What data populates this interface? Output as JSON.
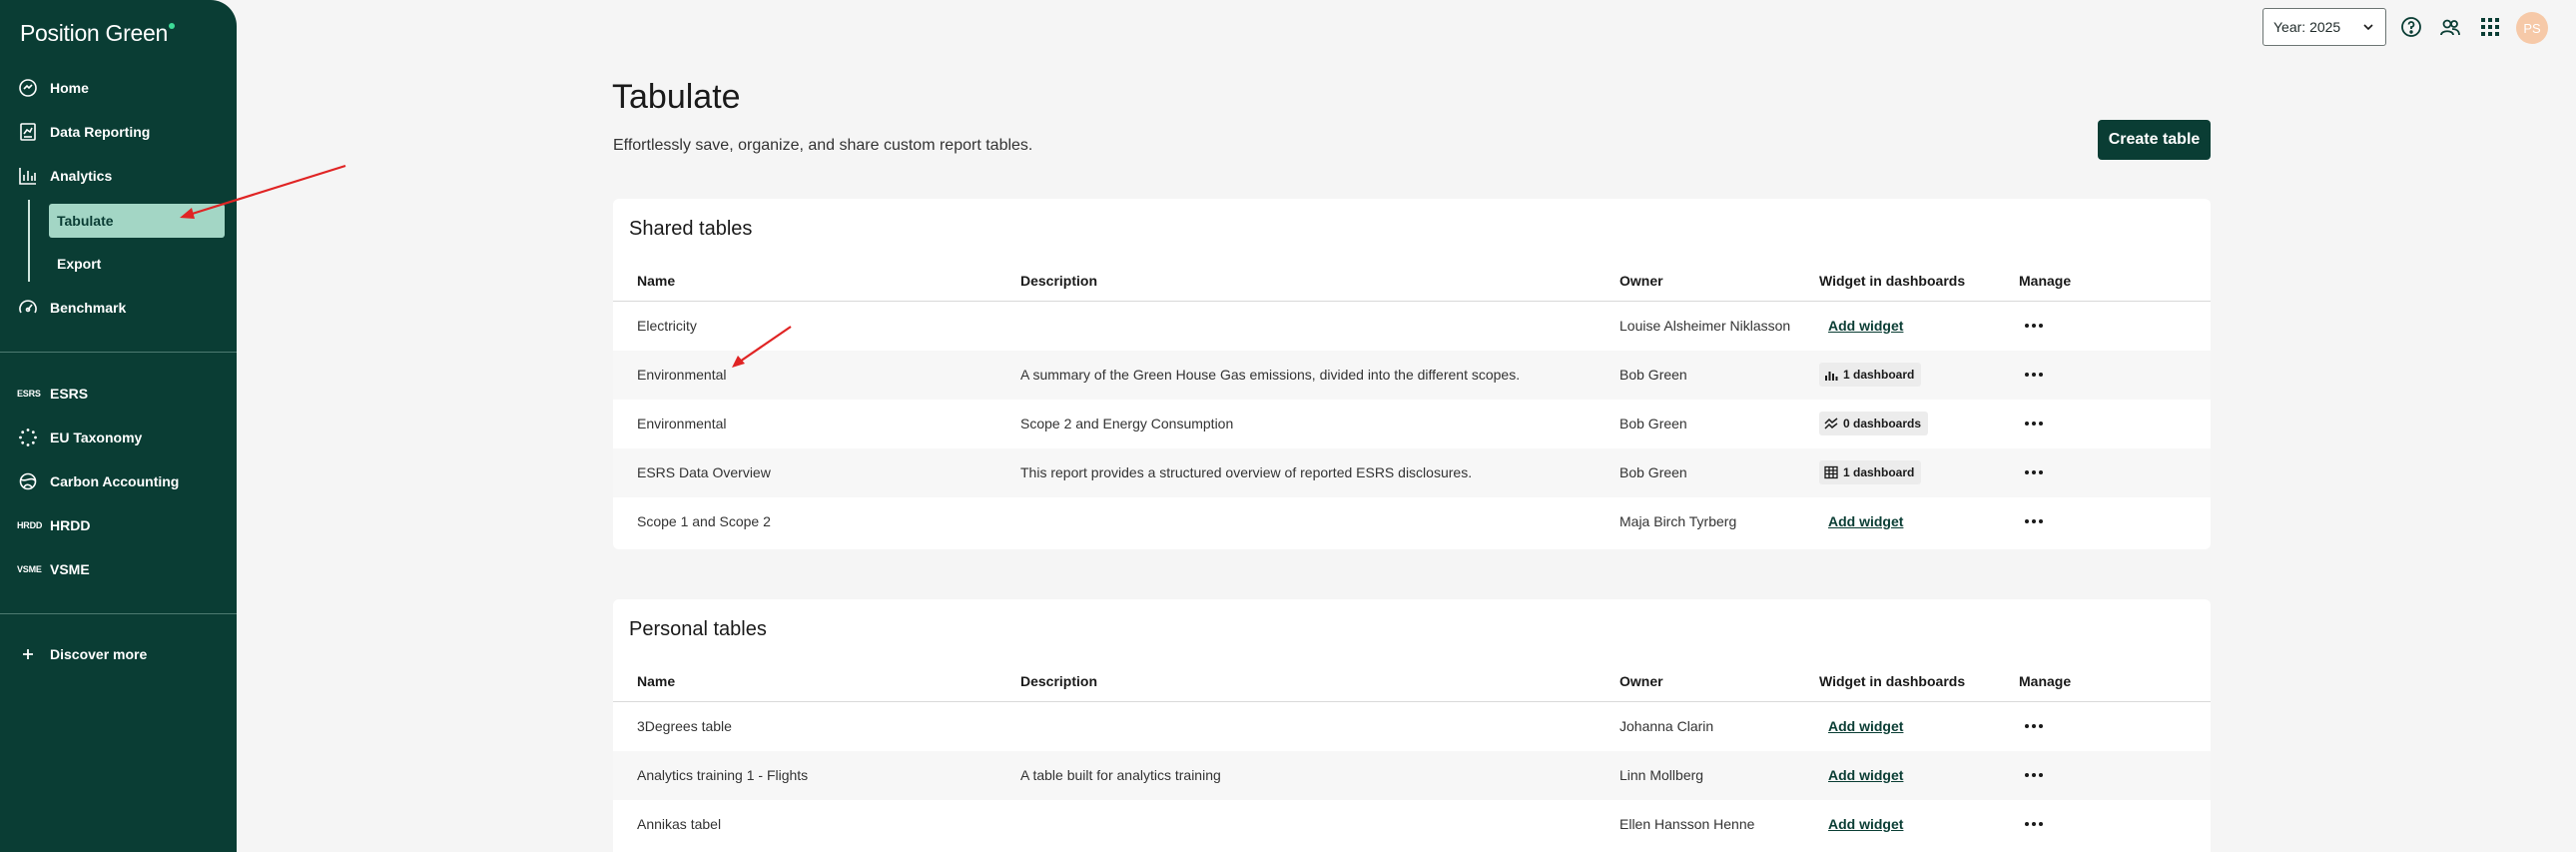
{
  "app": {
    "logo_text": "Position Green"
  },
  "sidebar": {
    "items": [
      {
        "label": "Home",
        "icon": "home-icon"
      },
      {
        "label": "Data Reporting",
        "icon": "data-reporting-icon"
      },
      {
        "label": "Analytics",
        "icon": "analytics-icon"
      },
      {
        "label": "Benchmark",
        "icon": "benchmark-icon"
      },
      {
        "label": "ESRS",
        "icon": "ESRS"
      },
      {
        "label": "EU Taxonomy",
        "icon": "eu-taxonomy-icon"
      },
      {
        "label": "Carbon Accounting",
        "icon": "carbon-accounting-icon"
      },
      {
        "label": "HRDD",
        "icon": "HRDD"
      },
      {
        "label": "VSME",
        "icon": "VSME"
      },
      {
        "label": "Discover more",
        "icon": "plus-icon"
      }
    ],
    "analytics_sub": [
      {
        "label": "Tabulate",
        "active": true
      },
      {
        "label": "Export",
        "active": false
      }
    ],
    "text_icons": {
      "esrs": "ESRS",
      "hrdd": "HRDD",
      "vsme": "VSME"
    }
  },
  "topbar": {
    "year_select": "Year: 2025",
    "avatar_initials": "PS"
  },
  "header": {
    "title": "Tabulate",
    "subtitle": "Effortlessly save, organize, and share custom report tables.",
    "create_button": "Create table"
  },
  "columns": [
    "Name",
    "Description",
    "Owner",
    "Widget in dashboards",
    "Manage"
  ],
  "shared_tables": {
    "title": "Shared tables",
    "rows": [
      {
        "name": "Electricity",
        "description": "",
        "owner": "Louise Alsheimer Niklasson",
        "widget": "Add widget",
        "widget_type": "link"
      },
      {
        "name": "Environmental",
        "description": "A summary of the Green House Gas emissions, divided into the different scopes.",
        "owner": "Bob Green",
        "widget": "1 dashboard",
        "widget_type": "badge",
        "badge_icon": "bar-chart-icon"
      },
      {
        "name": "Environmental",
        "description": "Scope 2 and Energy Consumption",
        "owner": "Bob Green",
        "widget": "0 dashboards",
        "widget_type": "badge",
        "badge_icon": "area-chart-icon"
      },
      {
        "name": "ESRS Data Overview",
        "description": "This report provides a structured overview of reported ESRS disclosures.",
        "owner": "Bob Green",
        "widget": "1 dashboard",
        "widget_type": "badge",
        "badge_icon": "table-icon"
      },
      {
        "name": "Scope 1 and Scope 2",
        "description": "",
        "owner": "Maja Birch Tyrberg",
        "widget": "Add widget",
        "widget_type": "link"
      }
    ]
  },
  "personal_tables": {
    "title": "Personal tables",
    "rows": [
      {
        "name": "3Degrees table",
        "description": "",
        "owner": "Johanna Clarin",
        "widget": "Add widget",
        "widget_type": "link"
      },
      {
        "name": "Analytics training 1 - Flights",
        "description": "A table built for analytics training",
        "owner": "Linn Mollberg",
        "widget": "Add widget",
        "widget_type": "link"
      },
      {
        "name": "Annikas tabel",
        "description": "",
        "owner": "Ellen Hansson Henne",
        "widget": "Add widget",
        "widget_type": "link"
      }
    ]
  },
  "colors": {
    "sidebar_bg": "#0a3d34",
    "active_sub_bg": "#a3d6c5",
    "annotation_arrow": "#e02424"
  }
}
